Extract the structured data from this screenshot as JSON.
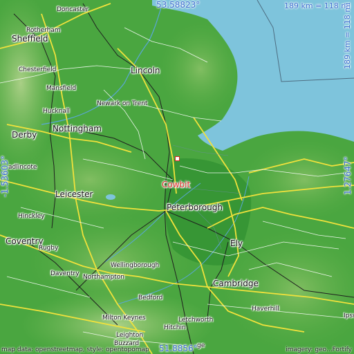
{
  "map": {
    "colors": {
      "sea": "#7ec4dc",
      "land_low": "#3a9a36",
      "land_mid": "#63b34a",
      "land_hill": "#9cc87a",
      "road_major": "#f1e23c",
      "road_minor": "#ffffff",
      "rail": "#222222",
      "marker": "#e02020"
    },
    "place": {
      "name": "Cowbit"
    },
    "coords": {
      "top": "53.58823°",
      "bottom": "51.8856°",
      "left": "-1.53603°",
      "right": "1.27647°"
    },
    "scale_top": "189 km = 118 mi",
    "scale_right": "189 km = 118 mi",
    "credit_left": "map data: openstreetmap, style: opentopomap",
    "credit_right": "imagery: geo...Fortify",
    "towns": [
      {
        "name": "Doncaster",
        "size": "small"
      },
      {
        "name": "Rotherham",
        "size": "small"
      },
      {
        "name": "Sheffield",
        "size": "big"
      },
      {
        "name": "Chesterfield",
        "size": "small"
      },
      {
        "name": "Lincoln",
        "size": "big"
      },
      {
        "name": "Mansfield",
        "size": "small"
      },
      {
        "name": "Newark on Trent",
        "size": "small"
      },
      {
        "name": "Hucknall",
        "size": "small"
      },
      {
        "name": "Derby",
        "size": "big"
      },
      {
        "name": "Nottingham",
        "size": "big"
      },
      {
        "name": "adlincote",
        "size": "small"
      },
      {
        "name": "Leicester",
        "size": "big"
      },
      {
        "name": "Peterborough",
        "size": "big"
      },
      {
        "name": "Hinckley",
        "size": "small"
      },
      {
        "name": "Coventry",
        "size": "big"
      },
      {
        "name": "Rugby",
        "size": "small"
      },
      {
        "name": "Ely",
        "size": "big"
      },
      {
        "name": "Wellingborough",
        "size": "small"
      },
      {
        "name": "Daventry",
        "size": "small"
      },
      {
        "name": "Northampton",
        "size": "small"
      },
      {
        "name": "Cambridge",
        "size": "big"
      },
      {
        "name": "Bedford",
        "size": "small"
      },
      {
        "name": "Haverhill",
        "size": "small"
      },
      {
        "name": "Milton Keynes",
        "size": "small"
      },
      {
        "name": "Letchworth",
        "size": "small"
      },
      {
        "name": "Hitchin",
        "size": "small"
      },
      {
        "name": "Leighton",
        "size": "small"
      },
      {
        "name": "Buzzard",
        "size": "small"
      },
      {
        "name": "Ipsw",
        "size": "small"
      },
      {
        "name": "ge",
        "size": "small"
      }
    ]
  }
}
